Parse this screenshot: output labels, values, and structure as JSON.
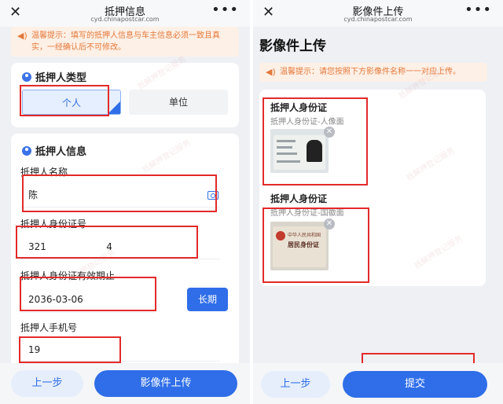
{
  "left": {
    "topbar": {
      "title": "抵押信息",
      "url": "cyd.chinapostcar.com",
      "close_icon": "close-icon",
      "more_icon": "more-icon"
    },
    "notice": {
      "icon": "speaker-icon",
      "line1": "温馨提示：填写的抵押人信息与车主信息必须一致且真",
      "line2": "实，一经确认后不可修改。"
    },
    "mortgagor_type": {
      "title": "抵押人类型",
      "options": [
        "个人",
        "单位"
      ],
      "selected": "个人"
    },
    "mortgagor_info": {
      "title": "抵押人信息",
      "name_label": "抵押人名称",
      "name_value": "陈",
      "id_label": "抵押人身份证号",
      "id_value": "321                    4",
      "expiry_label": "抵押人身份证有效期止",
      "expiry_value": "2036-03-06",
      "long_term_button": "长期",
      "phone_label": "抵押人手机号",
      "phone_value": "19"
    },
    "footer": {
      "prev": "上一步",
      "next": "影像件上传"
    }
  },
  "right": {
    "topbar": {
      "title": "影像件上传",
      "url": "cyd.chinapostcar.com",
      "close_icon": "close-icon",
      "more_icon": "more-icon"
    },
    "page_title": "影像件上传",
    "notice": {
      "icon": "speaker-icon",
      "text": "温馨提示：请您按照下方影像件名称一一对应上传。"
    },
    "docs": [
      {
        "title": "抵押人身份证",
        "subtitle": "抵押人身份证-人像面"
      },
      {
        "title": "抵押人身份证",
        "subtitle": "抵押人身份证-国徽面"
      }
    ],
    "id_card_emblem_text": "中华人民共和国",
    "id_card_title_text": "居民身份证",
    "footer": {
      "prev": "上一步",
      "submit": "提交"
    }
  },
  "colors": {
    "accent": "#2f6ee8",
    "annotation_red": "#e32a2a",
    "notice_bg": "#fdf0e6",
    "notice_text": "#e4793b"
  }
}
